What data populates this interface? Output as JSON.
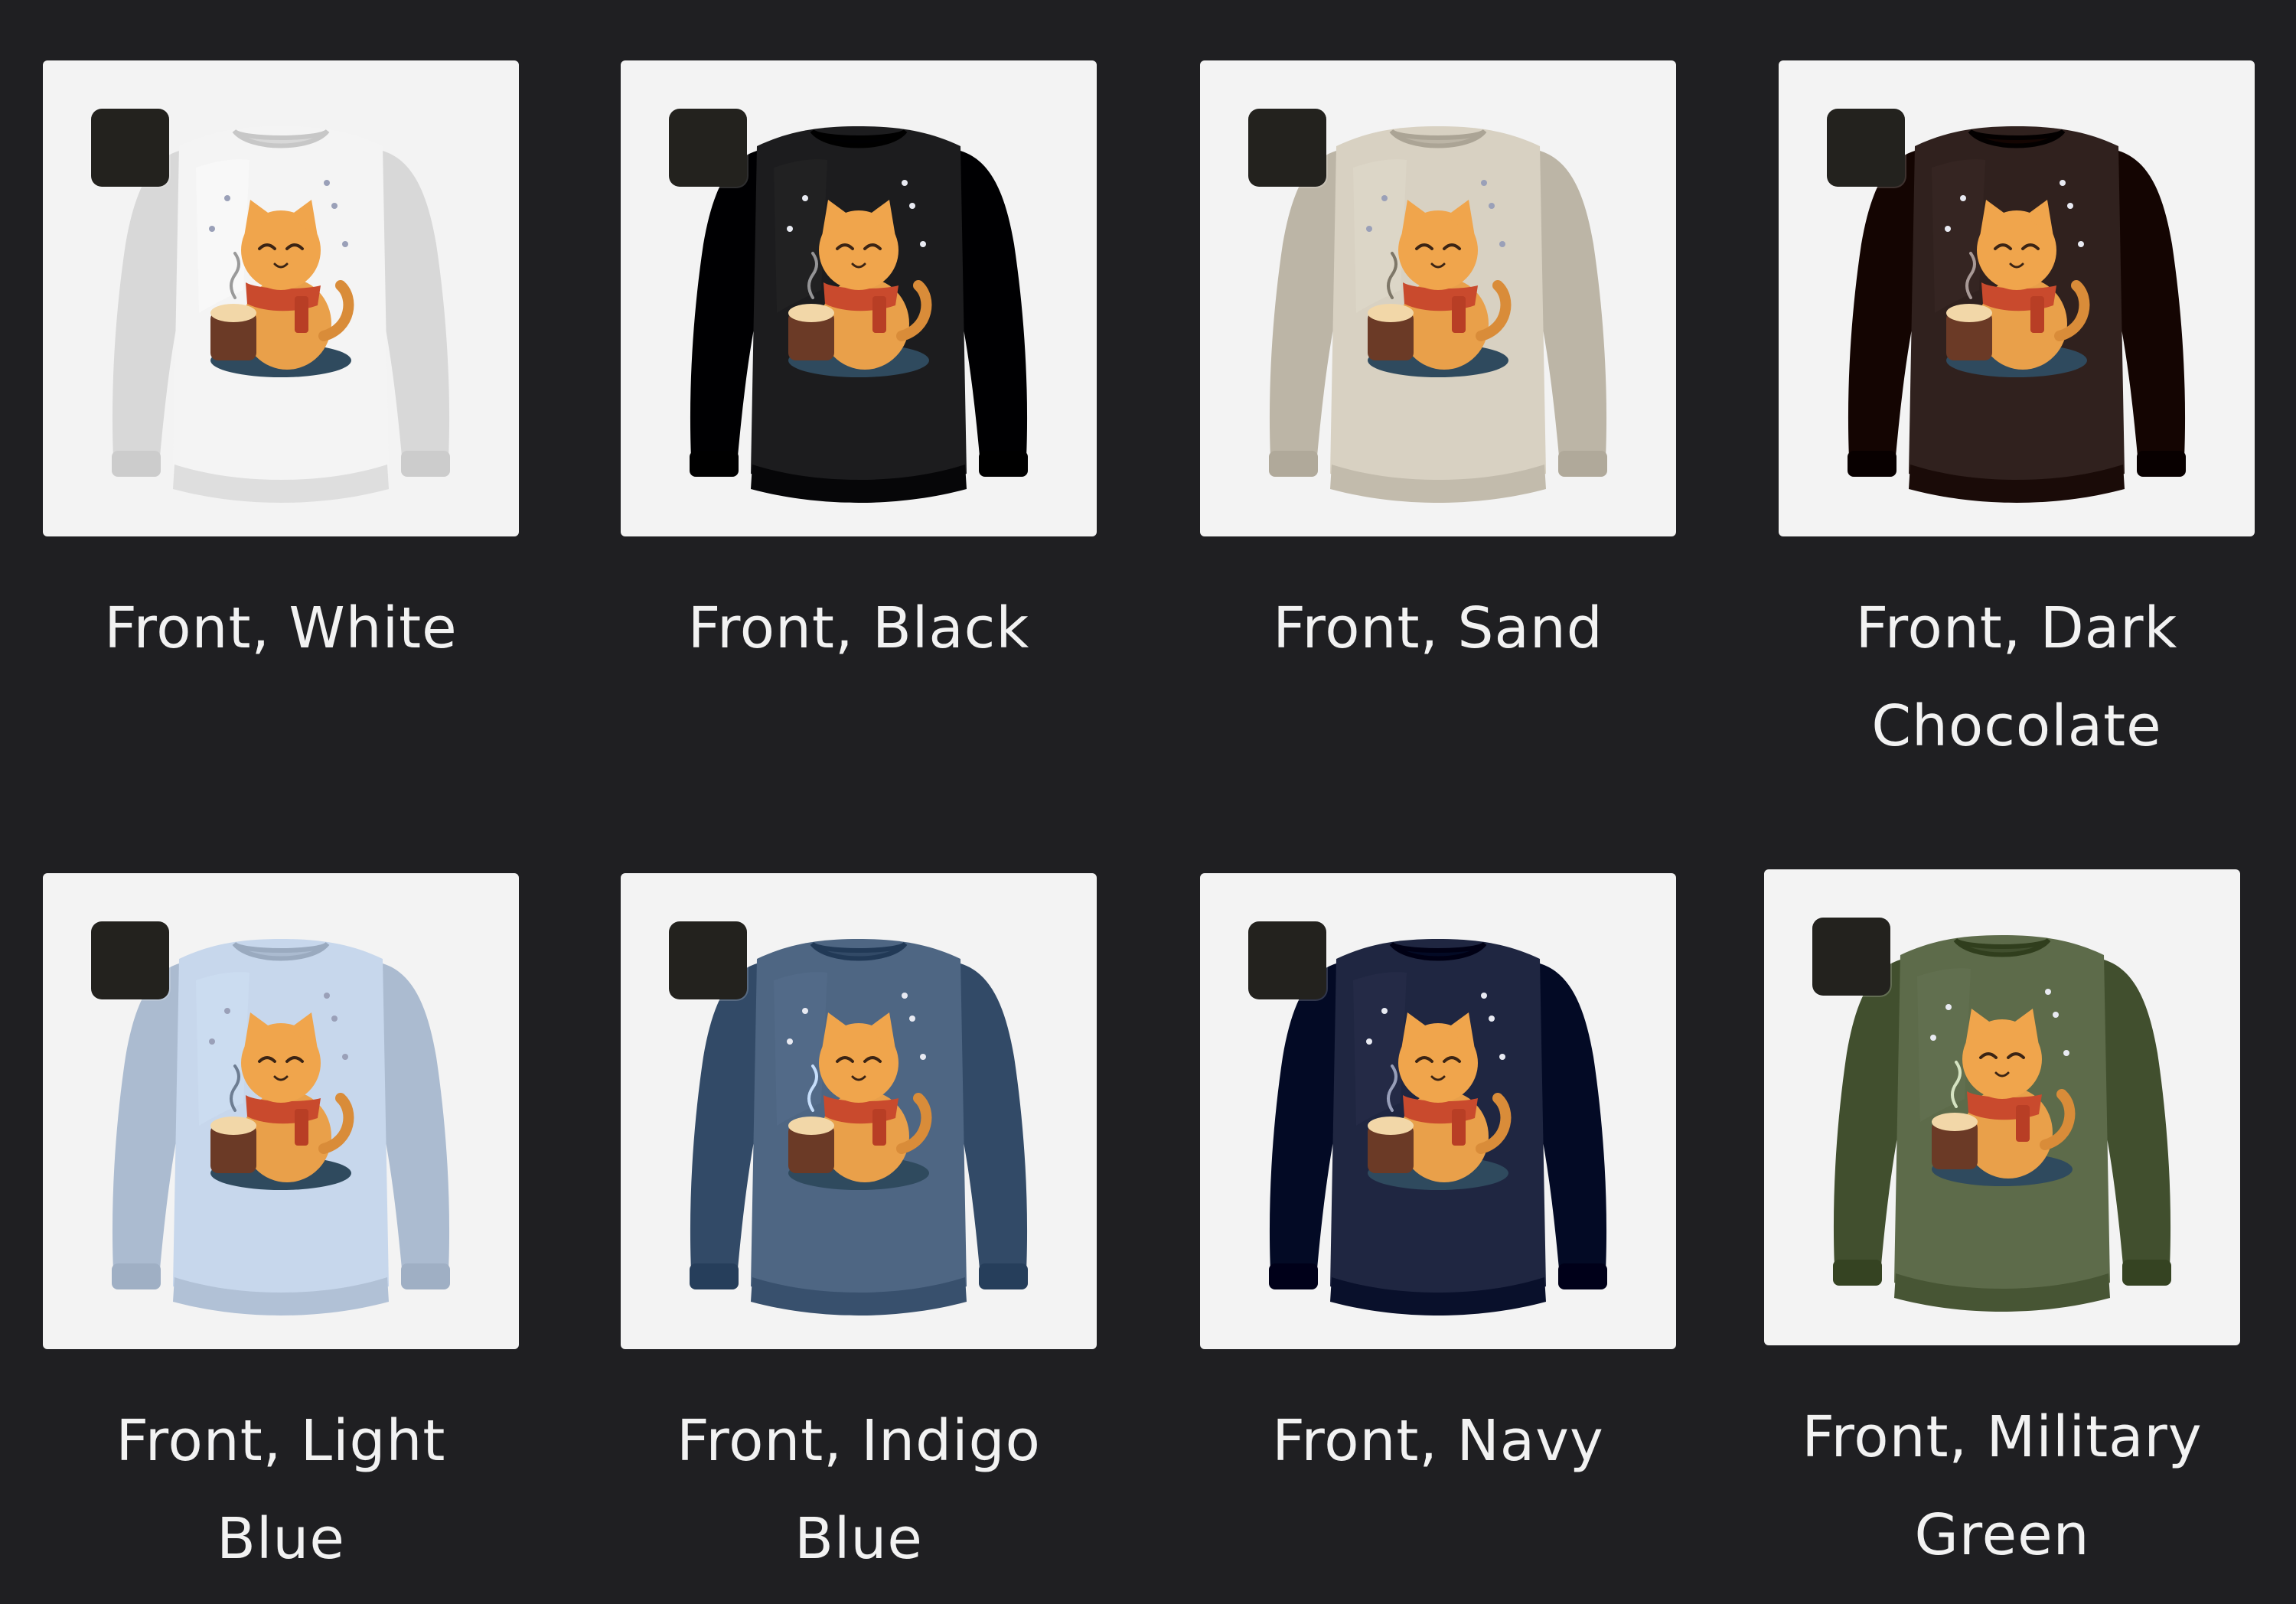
{
  "variants": [
    {
      "label": "Front, White",
      "color": "#f4f4f4"
    },
    {
      "label": "Front, Black",
      "color": "#1c1c1e"
    },
    {
      "label": "Front, Sand",
      "color": "#d8d1c2"
    },
    {
      "label": "Front, Dark Chocolate",
      "color": "#30211e"
    },
    {
      "label": "Front, Light Blue",
      "color": "#c7d7ec"
    },
    {
      "label": "Front, Indigo Blue",
      "color": "#4e6683"
    },
    {
      "label": "Front, Navy",
      "color": "#1f2641"
    },
    {
      "label": "Front, Military Green",
      "color": "#5d6b4a"
    }
  ],
  "colors": {
    "background": "#1f1f22",
    "card": "#f3f3f3",
    "swatch": "#23221e",
    "label": "#f2f2f2"
  },
  "icons": {
    "swatch": "color-swatch-icon",
    "product": "cat-cocoa-sweatshirt-image"
  }
}
